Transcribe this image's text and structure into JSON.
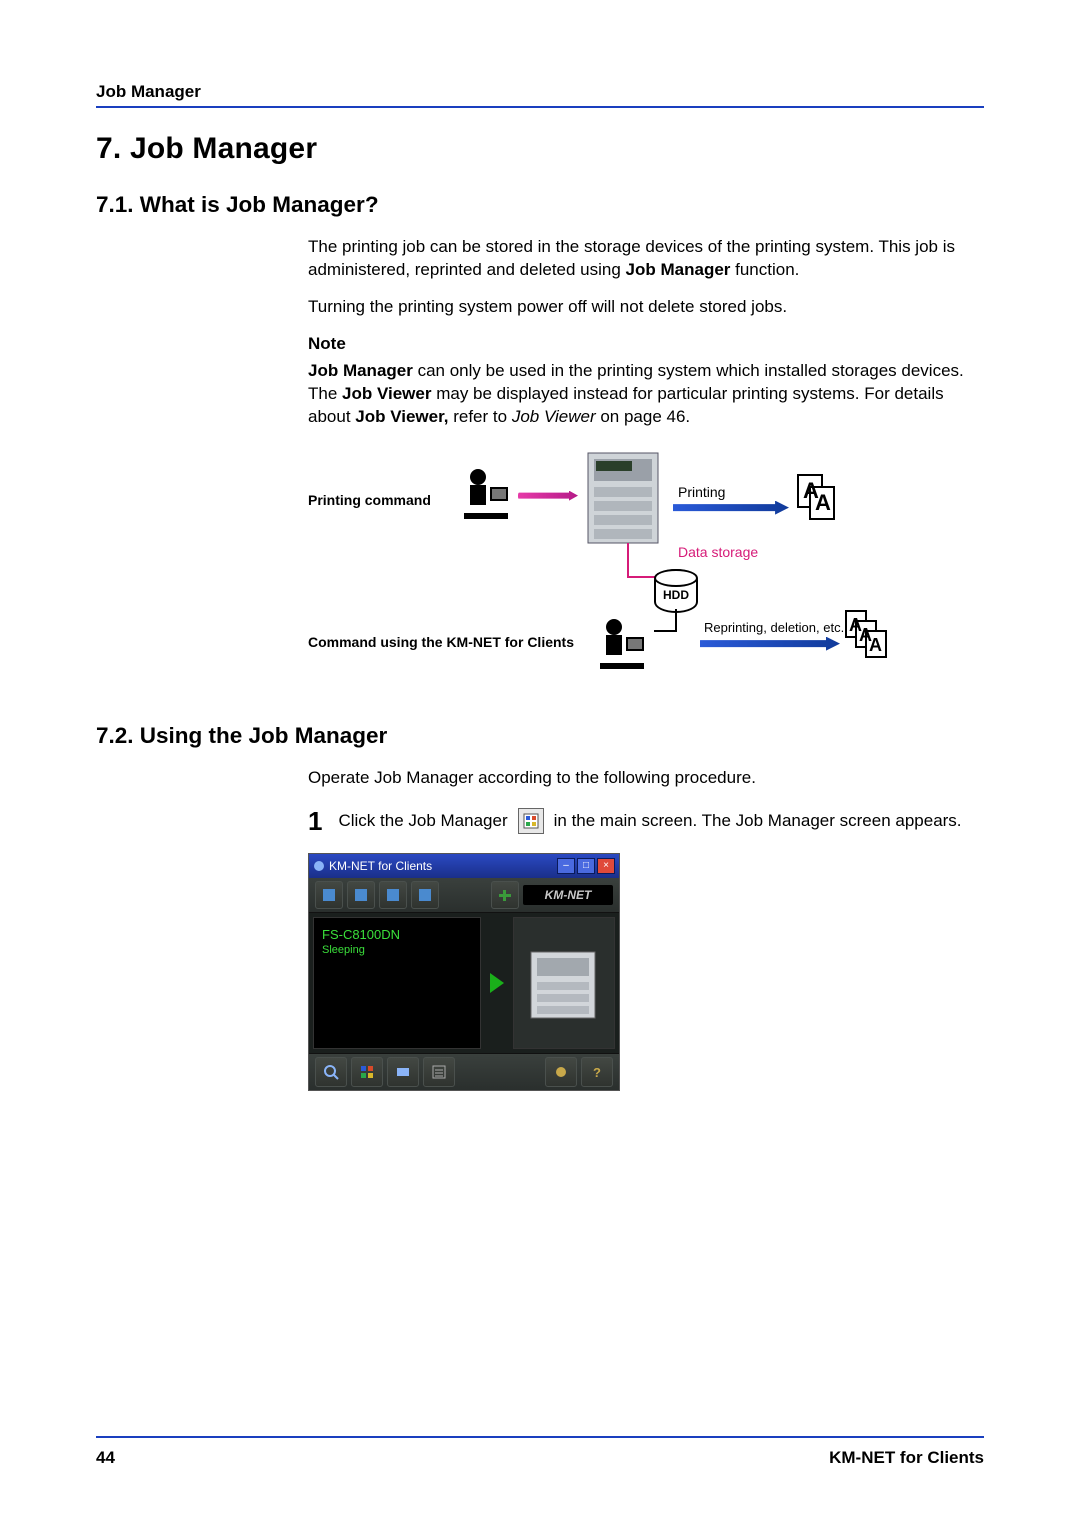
{
  "running_head": "Job Manager",
  "chapter_title": "7.  Job Manager",
  "section_7_1": {
    "heading": "7.1.  What is Job Manager?",
    "p1_a": "The printing job can be stored in the storage devices of the printing system. This job is administered, reprinted and deleted using ",
    "p1_b": "Job Manager",
    "p1_c": " function.",
    "p2": "Turning the printing system power off will not delete stored jobs.",
    "note_head": "Note",
    "p3_a": "Job Manager",
    "p3_b": " can only be used in the printing system which installed storages devices. The ",
    "p3_c": "Job Viewer",
    "p3_d": " may be displayed instead for particular printing systems. For details about ",
    "p3_e": "Job Viewer,",
    "p3_f": " refer to ",
    "p3_g": "Job Viewer",
    "p3_h": " on page 46."
  },
  "diagram": {
    "printing_command": "Printing command",
    "printing": "Printing",
    "data_storage": "Data storage",
    "hdd": "HDD",
    "command_kmnet": "Command using the KM-NET for Clients",
    "reprint": "Reprinting, deletion, etc.",
    "page_glyph": "A"
  },
  "section_7_2": {
    "heading": "7.2.  Using the Job Manager",
    "intro": "Operate Job Manager according to the following procedure.",
    "step1_num": "1",
    "step1_a": "Click the Job Manager",
    "step1_b": " in the main screen. The Job Manager screen appears."
  },
  "screenshot": {
    "title": "KM-NET for Clients",
    "logo": "KM-NET",
    "device": "FS-C8100DN",
    "status": "Sleeping"
  },
  "footer": {
    "page": "44",
    "doc": "KM-NET for Clients"
  }
}
